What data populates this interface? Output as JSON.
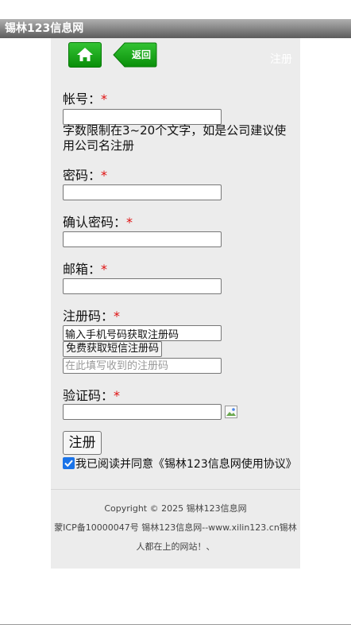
{
  "site": {
    "title": "锡林123信息网"
  },
  "nav": {
    "home_icon": "home-icon",
    "back_label": "返回",
    "page_title": "注册"
  },
  "form": {
    "account": {
      "label": "帐号：",
      "required": "*",
      "hint": "字数限制在3~20个文字，如是公司建议使用公司名注册"
    },
    "password": {
      "label": "密码：",
      "required": "*"
    },
    "confirm_password": {
      "label": "确认密码：",
      "required": "*"
    },
    "email": {
      "label": "邮箱：",
      "required": "*"
    },
    "reg_code": {
      "label": "注册码：",
      "required": "*",
      "phone_value": "输入手机号码获取注册码",
      "sms_button": "免费获取短信注册码",
      "code_placeholder": "在此填写收到的注册码"
    },
    "captcha": {
      "label": "验证码：",
      "required": "*"
    },
    "submit_label": "注册",
    "agree": {
      "checked": true,
      "text": "我已阅读并同意《锡林123信息网使用协议》"
    }
  },
  "footer": {
    "copyright": "Copyright © 2025 锡林123信息网",
    "icp_line1": "蒙ICP备10000047号 锡林123信息网--www.xilin123.cn锡林",
    "icp_line2": "人都在上的网站！、"
  },
  "colors": {
    "accent_green": "#1aa11a",
    "required_red": "#e01010",
    "checkbox_blue": "#1a73e8"
  }
}
